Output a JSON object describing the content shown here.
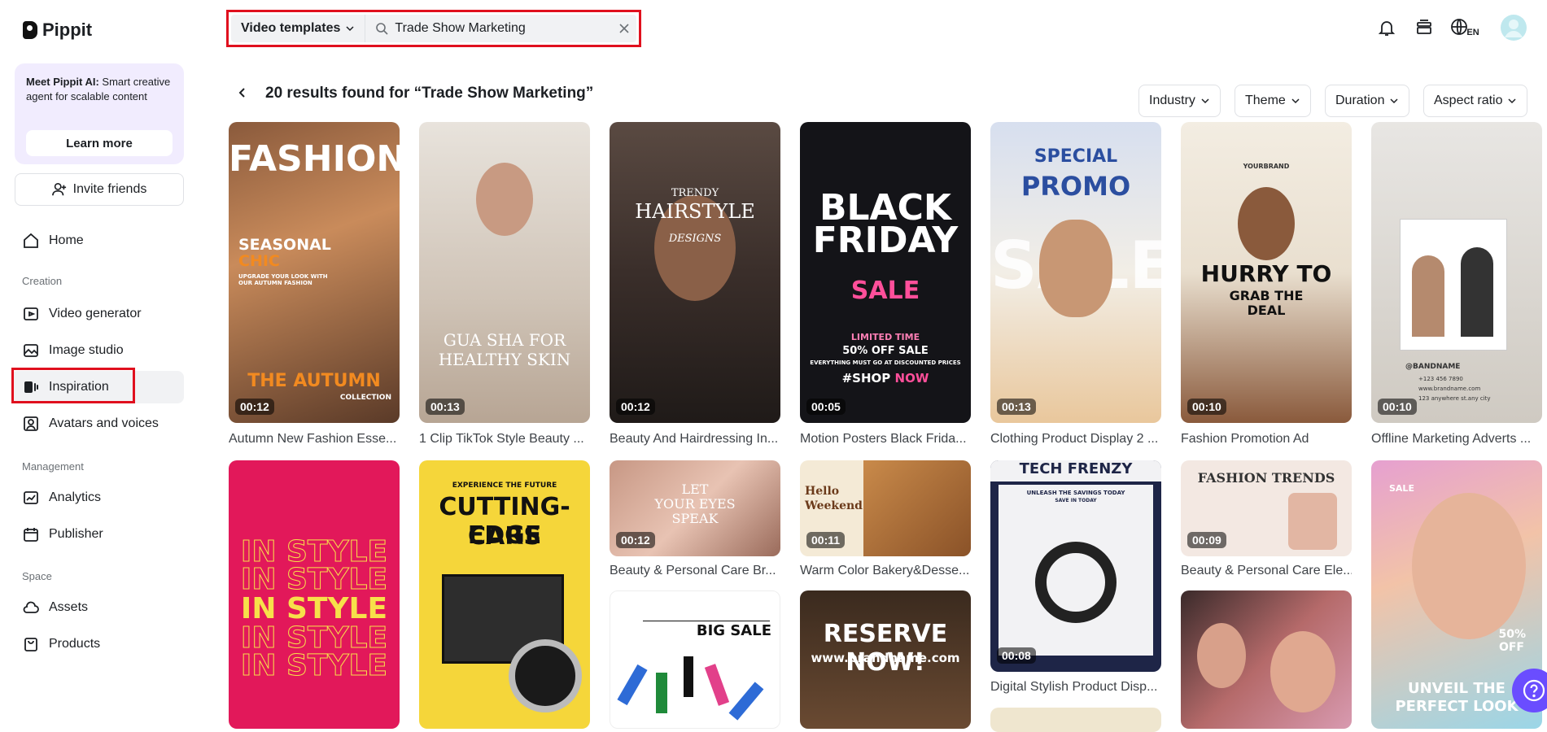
{
  "app": {
    "name": "Pippit"
  },
  "promo": {
    "text_bold": "Meet Pippit AI:",
    "text_rest": " Smart creative agent for scalable content",
    "button": "Learn more"
  },
  "invite_label": "Invite friends",
  "nav": {
    "home": "Home",
    "creation_section": "Creation",
    "video_generator": "Video generator",
    "image_studio": "Image studio",
    "inspiration": "Inspiration",
    "avatars": "Avatars and voices",
    "management_section": "Management",
    "analytics": "Analytics",
    "publisher": "Publisher",
    "space_section": "Space",
    "assets": "Assets",
    "products": "Products"
  },
  "search": {
    "type_label": "Video templates",
    "query": "Trade Show Marketing"
  },
  "topbar": {
    "lang": "EN"
  },
  "results": {
    "title": "20 results found for “Trade Show Marketing”"
  },
  "filters": {
    "industry": "Industry",
    "theme": "Theme",
    "duration": "Duration",
    "aspect": "Aspect ratio"
  },
  "cards": [
    {
      "title": "Autumn New Fashion Esse...",
      "duration": "00:12",
      "t1": "FASHION",
      "t2": "SEASONAL",
      "t3": "CHIC",
      "t4": "THE AUTUMN",
      "t5": "UPGRADE YOUR LOOK WITH OUR AUTUMN FASHION",
      "t6": "COLLECTION"
    },
    {
      "title": "1 Clip TikTok Style Beauty ...",
      "duration": "00:13",
      "t1": "GUA SHA FOR",
      "t2": "HEALTHY SKIN"
    },
    {
      "title": "Beauty And Hairdressing In...",
      "duration": "00:12",
      "t1": "TRENDY",
      "t2": "HAIRSTYLE",
      "t3": "DESIGNS"
    },
    {
      "title": "Motion Posters Black Frida...",
      "duration": "00:05",
      "t1": "BLACK",
      "t2": "FRIDAY",
      "t3": "SALE",
      "t4": "LIMITED TIME",
      "t5": "50% OFF SALE",
      "t6": "EVERYTHING MUST GO AT DISCOUNTED PRICES",
      "t7": "#SHOP",
      "t8": "NOW"
    },
    {
      "title": "Clothing Product Display 2 ...",
      "duration": "00:13",
      "t1": "SPECIAL",
      "t2": "PROMO",
      "t3": "SALE"
    },
    {
      "title": "Fashion Promotion Ad",
      "duration": "00:10",
      "t1": "HURRY TO",
      "t2": "GRAB THE",
      "t3": "DEAL",
      "t4": "YOURBRAND"
    },
    {
      "title": "Offline Marketing Adverts ...",
      "duration": "00:10",
      "t1": "@BANDNAME",
      "t2": "+123 456 7890",
      "t3": "www.brandname.com",
      "t4": "123 anywhere st.any city"
    },
    {
      "t1": "IN STYLE"
    },
    {
      "t1": "EXPERIENCE THE FUTURE",
      "t2": "CUTTING-EDGE",
      "t3": "CARS"
    },
    {
      "title": "Beauty & Personal Care Br...",
      "duration": "00:12",
      "t1": "LET",
      "t2": "YOUR EYES",
      "t3": "SPEAK"
    },
    {
      "title": "Warm Color Bakery&Desse...",
      "duration": "00:11",
      "t1": "Hello",
      "t2": "Weekend"
    },
    {
      "title": "Digital Stylish Product Disp...",
      "duration": "00:08",
      "t1": "TECH FRENZY",
      "t2": "UNLEASH THE SAVINGS TODAY",
      "t3": "SAVE IN TODAY"
    },
    {
      "title": "Beauty & Personal Care Ele...",
      "duration": "00:09",
      "t1": "FASHION TRENDS"
    },
    {
      "t1": "UNVEIL THE",
      "t2": "PERFECT LOOK",
      "t3": "SALE",
      "t4": "50%",
      "t5": "OFF"
    },
    {
      "t1": "BIG SALE"
    },
    {
      "t1": "RESERVE NOW!",
      "t2": "www.brandname.com"
    }
  ]
}
